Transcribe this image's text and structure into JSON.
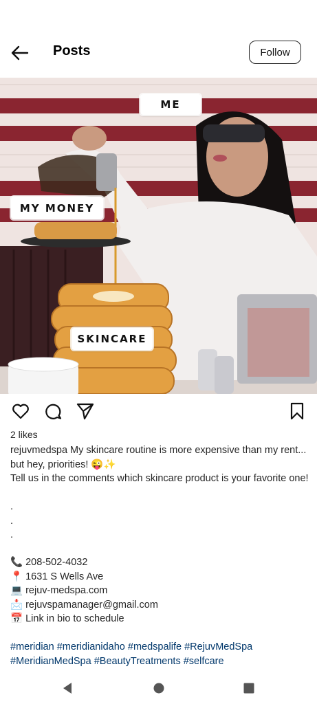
{
  "header": {
    "title": "Posts",
    "follow_label": "Follow"
  },
  "post": {
    "stickers": {
      "top": "ME",
      "middle": "MY MONEY",
      "bottom": "SKINCARE"
    },
    "likes": "2 likes",
    "username": "rejuvmedspa",
    "caption": " My skincare routine is more expensive than my rent... but hey, priorities! 😜✨\nTell us in the comments which skincare product is your favorite one!\n\n.\n.\n.",
    "contacts": [
      {
        "icon": "📞",
        "text": "208-502-4032"
      },
      {
        "icon": "📍",
        "text": "1631 S Wells Ave"
      },
      {
        "icon": "💻",
        "text": "rejuv-medspa.com"
      },
      {
        "icon": "📩",
        "text": "rejuvspamanager@gmail.com"
      },
      {
        "icon": "📅",
        "text": "Link in bio to schedule"
      }
    ],
    "hashtags": "#meridian #meridianidaho #medspalife #RejuvMedSpa #MeridianMedSpa #BeautyTreatments #selfcare"
  }
}
